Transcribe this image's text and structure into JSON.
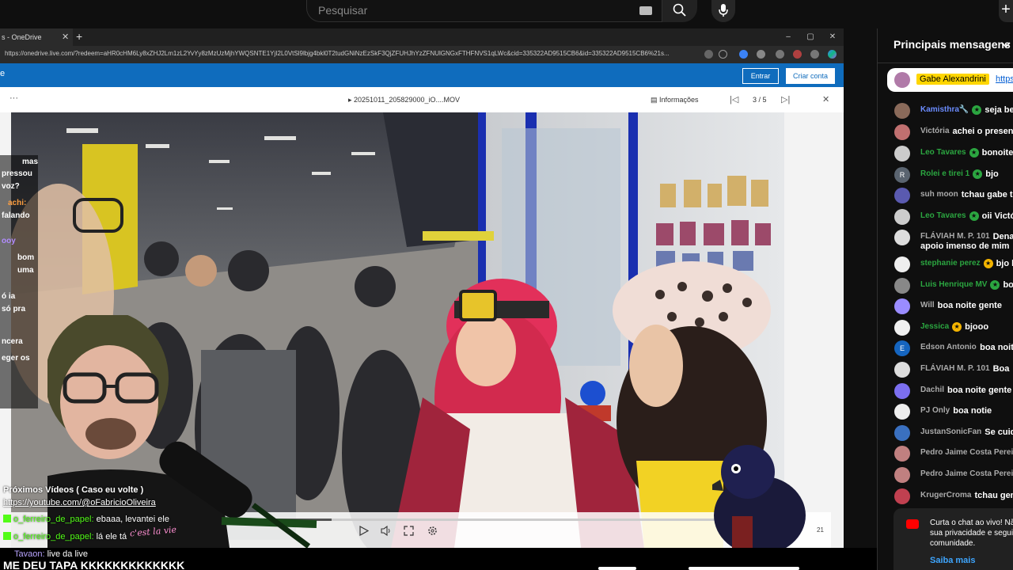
{
  "youtube": {
    "search_placeholder": "Pesquisar",
    "icons": [
      "keyboard-icon",
      "search-icon",
      "mic-icon",
      "create-icon"
    ]
  },
  "browser": {
    "tab_title": "s - OneDrive",
    "tab_close": "✕",
    "new_tab": "+",
    "url": "https://onedrive.live.com/?redeem=aHR0cHM6Ly8xZHJ2Lm1zL2YvYy8zMzUzMjhYWQSNTE1YjI2L0VtSl9lbjg4bkl0T2tudGNiNzEzSkF3QjZFUHJhYzZFNUlGNGxFTHFNVS1qLWc&cid=335322AD9515CB6&id=335322AD9515CB6%21s...",
    "window_controls": [
      "–",
      "▢",
      "✕"
    ]
  },
  "onedrive": {
    "left_text": "e",
    "sign_in": "Entrar",
    "create_account": "Criar conta",
    "more": "···",
    "file_name": "20251011_205829000_iO....MOV",
    "info": "Informações",
    "counter": "3 / 5",
    "close": "✕",
    "video_time": "21",
    "progress_fraction": 0.17
  },
  "overlay": {
    "side_chat": [
      {
        "text": "mas"
      },
      {
        "text": "pressou"
      },
      {
        "text": "voz?"
      },
      {
        "text": "achi:",
        "color": "#ff9f40"
      },
      {
        "text": "falando"
      },
      {
        "text": "ooy",
        "color": "#b18cff"
      },
      {
        "text": "bom"
      },
      {
        "text": "uma"
      },
      {
        "text": "ó      ia"
      },
      {
        "text": "só  pra"
      },
      {
        "text": "ncera"
      },
      {
        "text": "eger  os"
      }
    ],
    "next_videos": "Próximos Vídeos ( Caso eu volte )",
    "channel_url": "https://youtube.com/@oFabricioOliveira",
    "kick_messages": [
      {
        "user": "o_ferreiro_de_papel:",
        "text": "ebaaa, levantei ele"
      },
      {
        "user": "o_ferreiro_de_papel:",
        "text": "lá ele tá"
      }
    ],
    "cursive": "c'est la vie",
    "ticker_user": "Tavaon:",
    "ticker_text": "live da live",
    "ticker_loud": "ME DEU TAPA KKKKKKKKKKKKK"
  },
  "chat": {
    "title": "Principais mensagens",
    "pinned": {
      "author": "Gabe Alexandrini",
      "link": "https"
    },
    "messages": [
      {
        "author": "Kamisthra🔧",
        "text": "seja be",
        "color": "#6b8cff",
        "star": "#2ba640",
        "avatar": "#8a6a5a"
      },
      {
        "author": "Victória",
        "text": "achei o present",
        "color": "#aaaaaa",
        "avatar": "#c07070"
      },
      {
        "author": "Leo Tavares",
        "text": "bonoite",
        "color": "#2ba640",
        "star": "#2ba640",
        "avatar": "#cccccc"
      },
      {
        "author": "Rolei e tirei 1",
        "text": "bjo",
        "color": "#2ba640",
        "star": "#2ba640",
        "avatar": "#5a6470",
        "letter": "R"
      },
      {
        "author": "suh moon",
        "text": "tchau gabe to",
        "color": "#aaaaaa",
        "avatar": "#5a5ab0"
      },
      {
        "author": "Leo Tavares",
        "text": "oii Victó",
        "color": "#2ba640",
        "star": "#2ba640",
        "avatar": "#cccccc"
      },
      {
        "author": "FLÁVIAH M. P. 101",
        "text": "Dena",
        "text2": "apoio imenso de mim",
        "color": "#aaaaaa",
        "avatar": "#dddddd",
        "tall": true
      },
      {
        "author": "stephanie perez",
        "text": "bjo l",
        "color": "#2ba640",
        "star": "#f4b400",
        "avatar": "#eeeeee"
      },
      {
        "author": "Luis Henrique MV",
        "text": "bo",
        "color": "#2ba640",
        "star": "#2ba640",
        "avatar": "#888888"
      },
      {
        "author": "Will",
        "text": "boa noite gente",
        "color": "#aaaaaa",
        "avatar": "#9a8cff"
      },
      {
        "author": "Jessica",
        "text": "bjooo",
        "color": "#2ba640",
        "star": "#f4b400",
        "avatar": "#f0f0f0"
      },
      {
        "author": "Edson Antonio",
        "text": "boa noite",
        "color": "#aaaaaa",
        "avatar": "#1565c0",
        "letter": "E"
      },
      {
        "author": "FLÁVIAH M. P. 101",
        "text": "Boa",
        "color": "#aaaaaa",
        "avatar": "#dddddd"
      },
      {
        "author": "Dachil",
        "text": "boa noite gente",
        "color": "#aaaaaa",
        "avatar": "#7c6ff0"
      },
      {
        "author": "PJ Only",
        "text": "boa notie",
        "color": "#aaaaaa",
        "avatar": "#eeeeee"
      },
      {
        "author": "JustanSonicFan",
        "text": "Se cuid",
        "color": "#aaaaaa",
        "avatar": "#3a70c0"
      },
      {
        "author": "Pedro Jaime Costa Perei",
        "text": "",
        "color": "#aaaaaa",
        "avatar": "#c08080"
      },
      {
        "author": "Pedro Jaime Costa Perei",
        "text": "",
        "color": "#aaaaaa",
        "avatar": "#c08080"
      },
      {
        "author": "KrugerCroma",
        "text": "tchau gen",
        "color": "#aaaaaa",
        "avatar": "#c04050"
      }
    ],
    "promo_text": "Curta o chat ao vivo! Nã sua privacidade e segui comunidade.",
    "promo_link": "Saiba mais"
  }
}
